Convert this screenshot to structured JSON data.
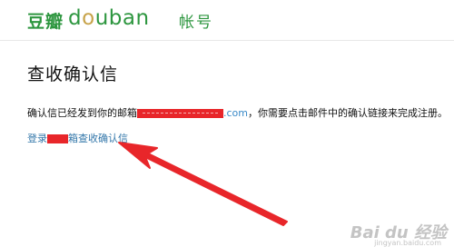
{
  "header": {
    "logo_cn": "豆瓣",
    "logo_en_prefix": "d",
    "logo_en_o": "o",
    "logo_en_suffix": "uban",
    "account_label": "帐号"
  },
  "main": {
    "title": "查收确认信",
    "message_prefix": "确认信已经发到你的邮箱",
    "email_domain": ".com",
    "message_suffix": "，你需要点击邮件中的确认链接来完成注册。",
    "login_prefix": "登录",
    "login_suffix": "箱查收确认信"
  },
  "watermark": {
    "text": "Bai du 经验",
    "sub": "jingyan.baidu.com"
  },
  "colors": {
    "brand_green": "#2d963f",
    "link_blue": "#3377aa",
    "annotation_red": "#e8262a"
  }
}
